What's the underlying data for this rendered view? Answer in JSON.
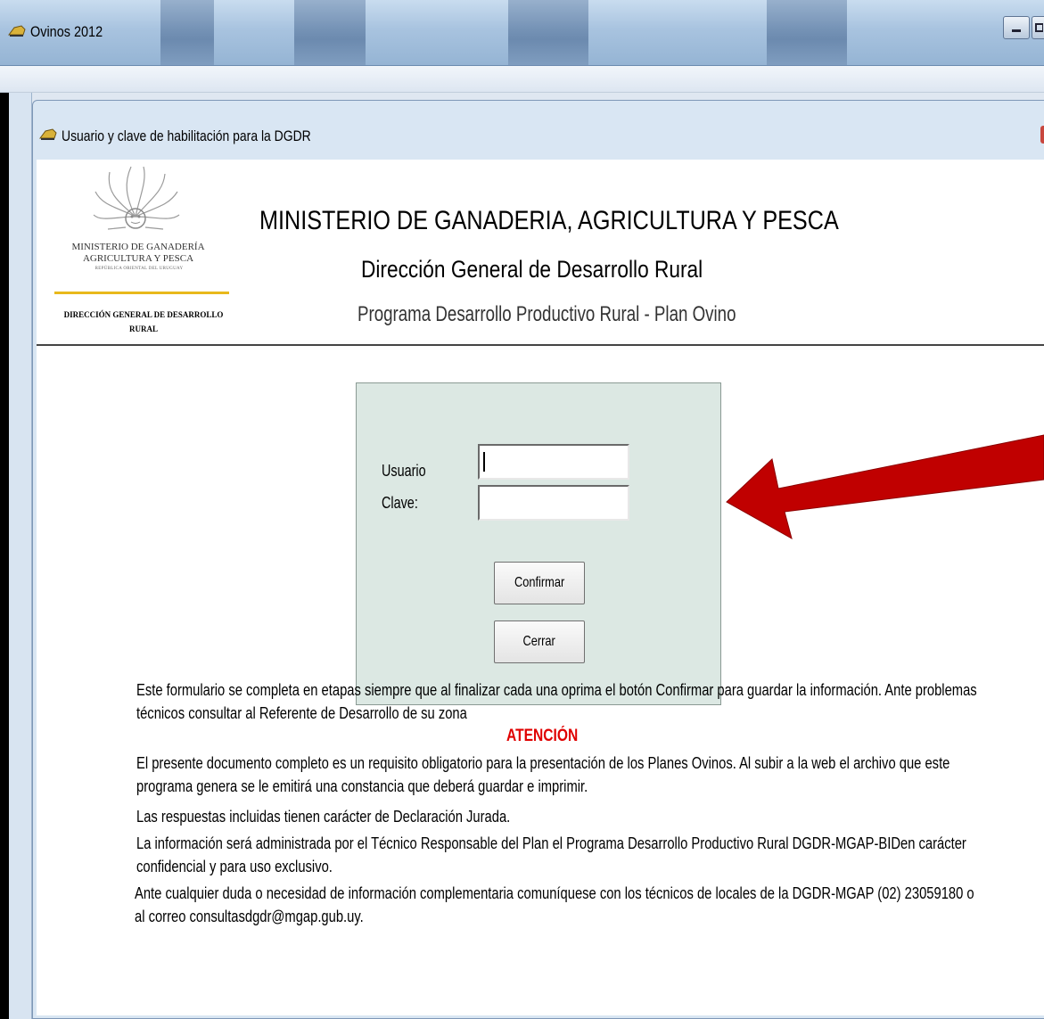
{
  "outer_window": {
    "title": "Ovinos 2012",
    "controls": [
      "minimize",
      "maximize"
    ]
  },
  "dialog": {
    "title": "Usuario y clave de habilitación para la DGDR"
  },
  "logo": {
    "org_line1": "MINISTERIO DE GANADERÍA",
    "org_line2": "AGRICULTURA Y PESCA",
    "sub": "REPÚBLICA ORIENTAL DEL URUGUAY",
    "dept_line1": "DIRECCIÓN GENERAL DE DESARROLLO",
    "dept_line2": "RURAL"
  },
  "header": {
    "title": "MINISTERIO DE GANADERIA, AGRICULTURA Y PESCA",
    "subtitle": "Dirección General de Desarrollo Rural",
    "program": "Programa Desarrollo Productivo Rural - Plan Ovino"
  },
  "login": {
    "usuario_label": "Usuario",
    "usuario_value": "",
    "clave_label": "Clave:",
    "clave_value": "",
    "confirm_label": "Confirmar",
    "close_label": "Cerrar"
  },
  "info": {
    "para1_line1": "Este formulario se completa en etapas siempre que al finalizar cada una oprima el botón Confirmar para guardar la información.  Ante problemas",
    "para1_line2": "técnicos consultar al Referente de Desarrollo de su zona",
    "attention": "ATENCIÓN",
    "para2_line1": "El presente documento completo es un requisito obligatorio para la  presentación de los Planes Ovinos. Al subir a la web el archivo que este",
    "para2_line2": "programa genera se le emitirá una constancia que deberá guardar e imprimir.",
    "para3": "Las respuestas incluidas tienen carácter de Declaración Jurada.",
    "para4_line1": "La información será administrada por el  Técnico Responsable del Plan  el Programa Desarrollo Productivo Rural DGDR-MGAP-BIDen carácter",
    "para4_line2": "confidencial y para uso exclusivo.",
    "para5_line1": "Ante cualquier duda o necesidad de información complementaria comuníquese con los técnicos de locales de la DGDR-MGAP (02) 23059180 o",
    "para5_line2": "al correo consultasdgdr@mgap.gub.uy."
  },
  "colors": {
    "arrow": "#c00000",
    "attention": "#e00000",
    "panel_bg": "#dce8e3",
    "logo_bar": "#e8b81c"
  }
}
